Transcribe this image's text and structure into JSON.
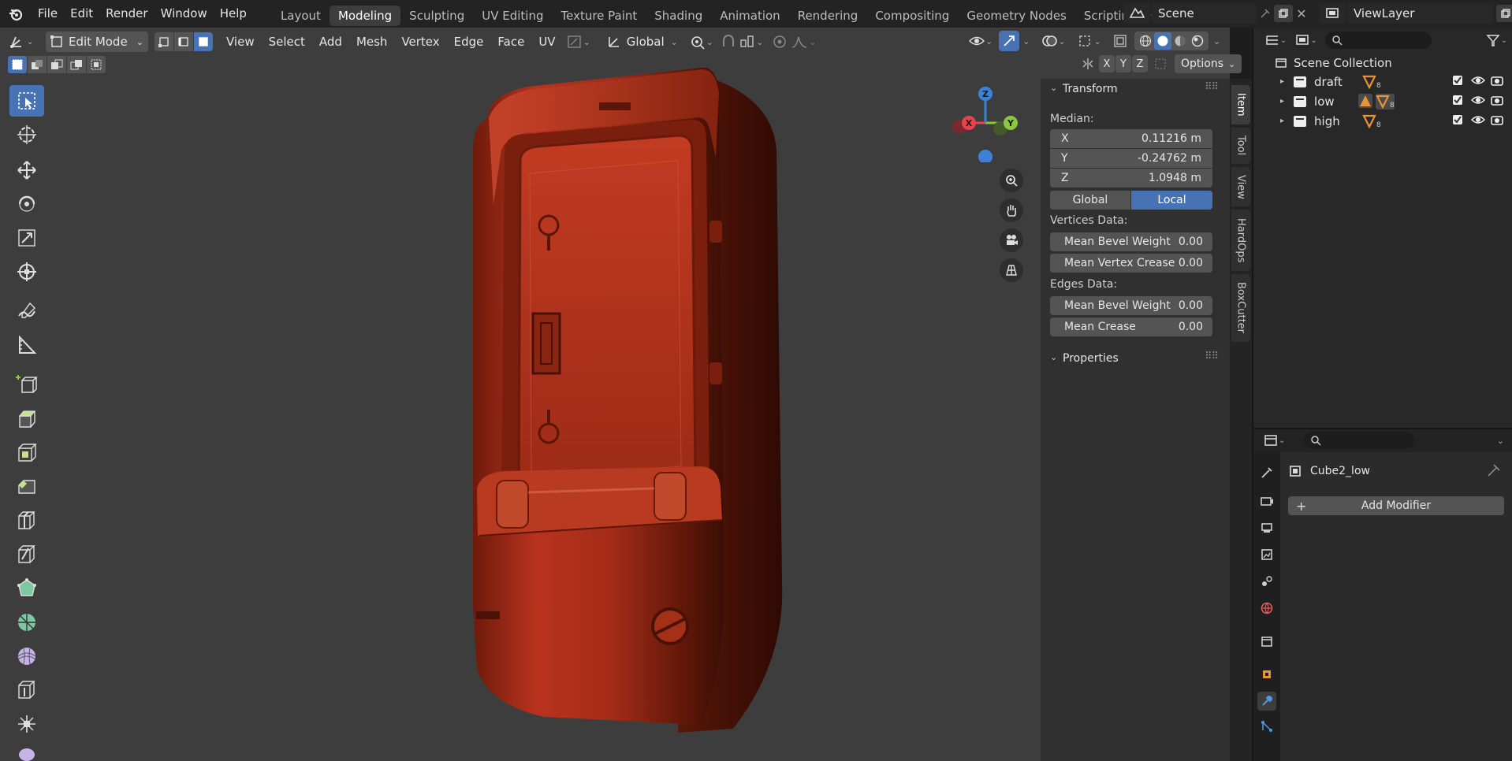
{
  "topbar": {
    "menus": [
      "File",
      "Edit",
      "Render",
      "Window",
      "Help"
    ],
    "workspace_tabs": [
      "Layout",
      "Modeling",
      "Sculpting",
      "UV Editing",
      "Texture Paint",
      "Shading",
      "Animation",
      "Rendering",
      "Compositing",
      "Geometry Nodes",
      "Scripting"
    ],
    "active_tab": "Modeling",
    "scene": "Scene",
    "view_layer": "ViewLayer"
  },
  "viewport_header": {
    "mode": "Edit Mode",
    "menus": [
      "View",
      "Select",
      "Add",
      "Mesh",
      "Vertex",
      "Edge",
      "Face",
      "UV"
    ],
    "transform_orientation": "Global",
    "options_label": "Options",
    "axis_x": "X",
    "axis_y": "Y",
    "axis_z": "Z"
  },
  "gizmo": {
    "x": "X",
    "y": "Y",
    "z": "Z",
    "colors": {
      "x": "#e8424b",
      "y": "#8cc63f",
      "z": "#3b82d6"
    }
  },
  "npanel": {
    "tabs": [
      "Item",
      "Tool",
      "View",
      "HardOps",
      "BoxCutter"
    ],
    "active_tab": "Item",
    "transform_title": "Transform",
    "median_label": "Median:",
    "x_label": "X",
    "x_value": "0.11216 m",
    "y_label": "Y",
    "y_value": "-0.24762 m",
    "z_label": "Z",
    "z_value": "1.0948 m",
    "global_label": "Global",
    "local_label": "Local",
    "vertices_data": "Vertices Data:",
    "mean_bevel_weight": "Mean Bevel Weight",
    "mean_bevel_weight_v": "0.00",
    "mean_vertex_crease": "Mean Vertex Crease",
    "mean_vertex_crease_v": "0.00",
    "edges_data": "Edges Data:",
    "edge_mean_bevel_weight": "Mean Bevel Weight",
    "edge_mean_bevel_weight_v": "0.00",
    "mean_crease": "Mean Crease",
    "mean_crease_v": "0.00",
    "properties_title": "Properties"
  },
  "outliner": {
    "root": "Scene Collection",
    "collections": [
      {
        "name": "draft",
        "count": "8"
      },
      {
        "name": "low",
        "count": "8"
      },
      {
        "name": "high",
        "count": "8"
      }
    ]
  },
  "properties": {
    "object_name": "Cube2_low",
    "add_modifier": "Add Modifier"
  },
  "colors": {
    "accent": "#4772b3",
    "object": "#b8331e",
    "object_dark": "#5a1709",
    "header_bg": "#232323",
    "viewport_bg": "#3d3d3d"
  }
}
